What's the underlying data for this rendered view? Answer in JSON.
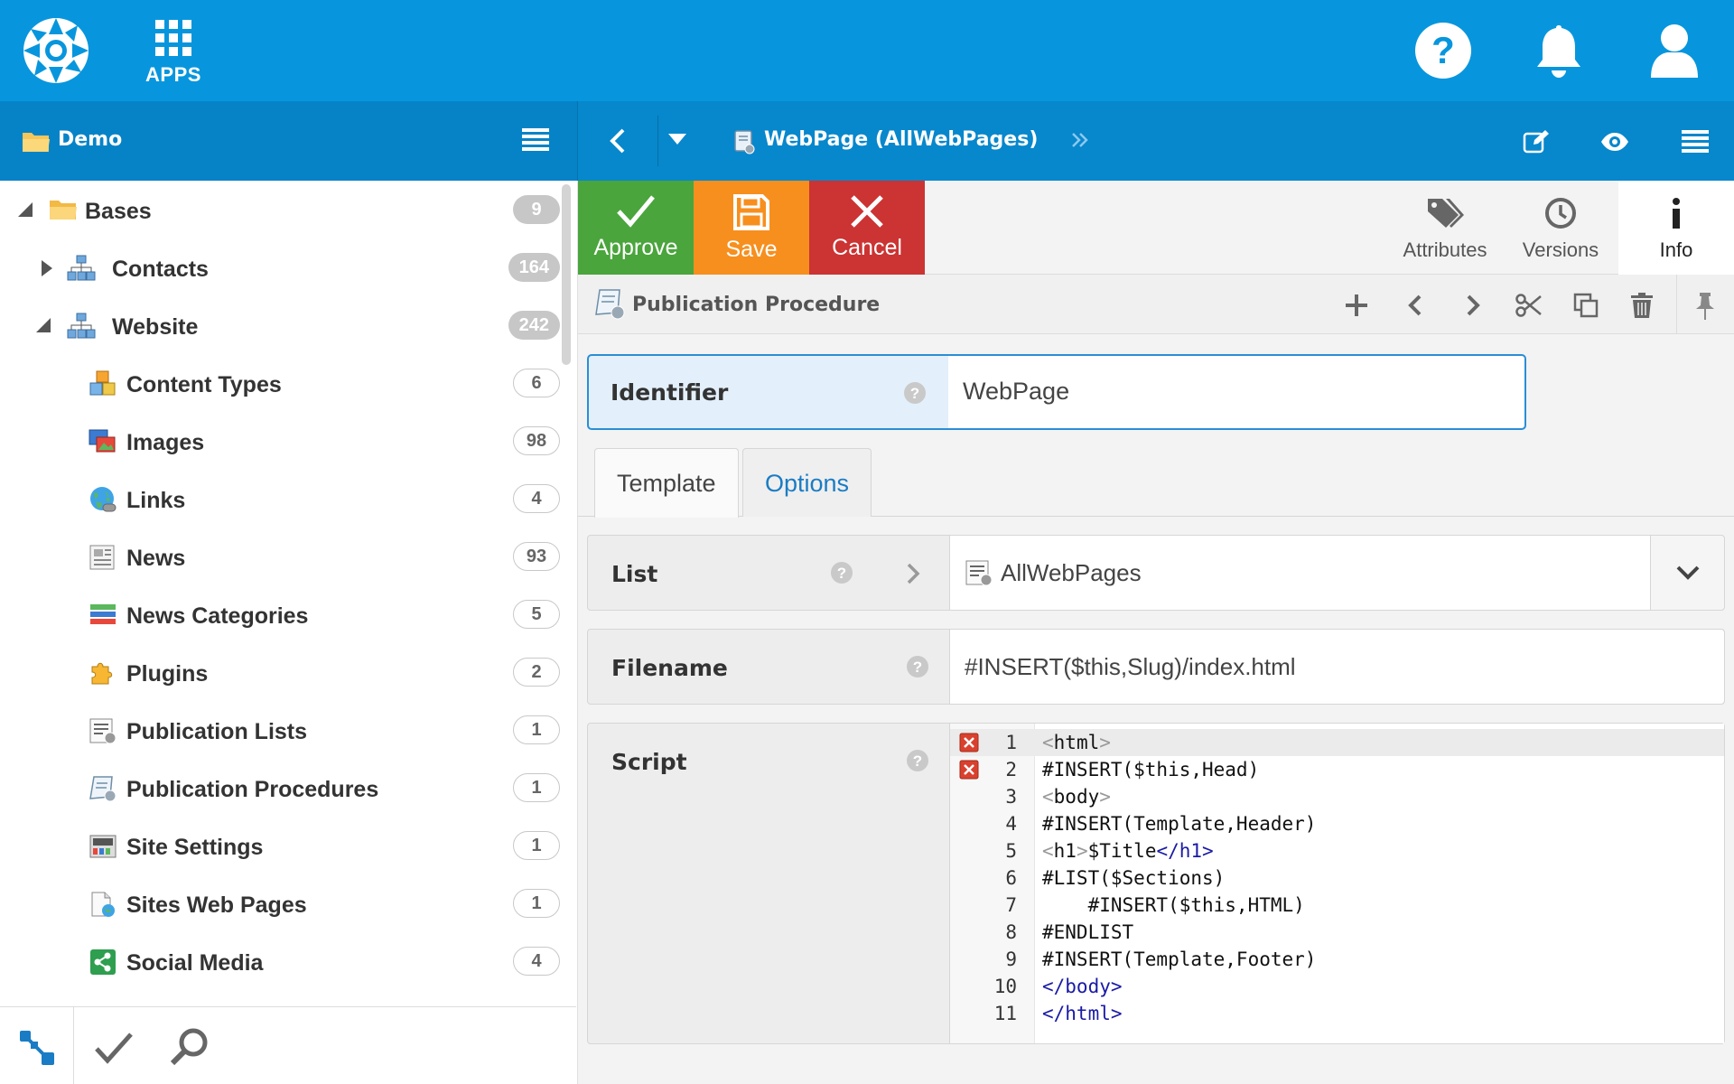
{
  "header": {
    "apps_label": "APPS"
  },
  "nav": {
    "project": "Demo",
    "page_title": "WebPage (AllWebPages)"
  },
  "sidebar": {
    "items": [
      {
        "label": "Bases",
        "count": "9",
        "icon": "folder-icon",
        "expanded": true
      },
      {
        "label": "Contacts",
        "count": "164",
        "icon": "database-icon",
        "expanded": false
      },
      {
        "label": "Website",
        "count": "242",
        "icon": "database-icon",
        "expanded": true
      },
      {
        "label": "Content Types",
        "count": "6",
        "icon": "cubes-icon"
      },
      {
        "label": "Images",
        "count": "98",
        "icon": "images-icon"
      },
      {
        "label": "Links",
        "count": "4",
        "icon": "globe-link-icon"
      },
      {
        "label": "News",
        "count": "93",
        "icon": "newspaper-icon"
      },
      {
        "label": "News Categories",
        "count": "5",
        "icon": "categories-icon"
      },
      {
        "label": "Plugins",
        "count": "2",
        "icon": "puzzle-icon"
      },
      {
        "label": "Publication Lists",
        "count": "1",
        "icon": "list-gear-icon"
      },
      {
        "label": "Publication Procedures",
        "count": "1",
        "icon": "scroll-gear-icon"
      },
      {
        "label": "Site Settings",
        "count": "1",
        "icon": "settings-panel-icon"
      },
      {
        "label": "Sites Web Pages",
        "count": "1",
        "icon": "web-page-icon"
      },
      {
        "label": "Social Media",
        "count": "4",
        "icon": "share-icon"
      }
    ]
  },
  "toolbar": {
    "approve": "Approve",
    "save": "Save",
    "cancel": "Cancel",
    "attributes": "Attributes",
    "versions": "Versions",
    "info": "Info",
    "colors": {
      "approve": "#4aa53c",
      "save": "#f78f1e",
      "cancel": "#cc3333"
    }
  },
  "record": {
    "type_title": "Publication Procedure",
    "identifier_label": "Identifier",
    "identifier_value": "WebPage",
    "tabs": [
      "Template",
      "Options"
    ],
    "list_label": "List",
    "list_value": "AllWebPages",
    "filename_label": "Filename",
    "filename_value": "#INSERT($this,Slug)/index.html",
    "script_label": "Script",
    "script_lines": [
      {
        "n": "1",
        "text": "<html>",
        "error": true
      },
      {
        "n": "2",
        "text": "#INSERT($this,Head)",
        "error": true
      },
      {
        "n": "3",
        "text": "<body>",
        "error": false
      },
      {
        "n": "4",
        "text": "#INSERT(Template,Header)",
        "error": false
      },
      {
        "n": "5",
        "text": "<h1>$Title</h1>",
        "error": false
      },
      {
        "n": "6",
        "text": "#LIST($Sections)",
        "error": false
      },
      {
        "n": "7",
        "text": "    #INSERT($this,HTML)",
        "error": false
      },
      {
        "n": "8",
        "text": "#ENDLIST",
        "error": false
      },
      {
        "n": "9",
        "text": "#INSERT(Template,Footer)",
        "error": false
      },
      {
        "n": "10",
        "text": "</body>",
        "error": false
      },
      {
        "n": "11",
        "text": "</html>",
        "error": false
      }
    ]
  }
}
